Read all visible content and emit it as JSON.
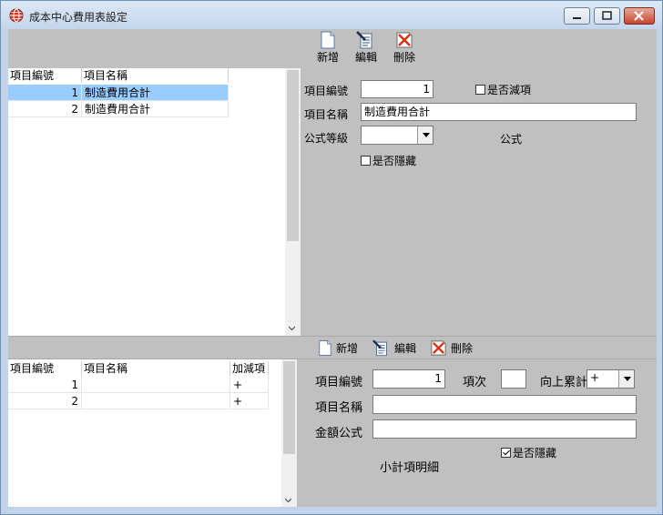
{
  "window": {
    "title": "成本中心費用表設定",
    "icon": "globe-icon"
  },
  "top": {
    "toolbar": {
      "add_label": "新增",
      "edit_label": "編輯",
      "delete_label": "刪除"
    },
    "grid": {
      "columns": [
        "項目編號",
        "項目名稱"
      ],
      "rows": [
        {
          "id": "1",
          "name": "制造費用合計",
          "selected": true
        },
        {
          "id": "2",
          "name": "制造費用合計",
          "selected": false
        }
      ]
    },
    "form": {
      "item_no_label": "項目編號",
      "item_no_value": "1",
      "is_deduct_label": "是否減項",
      "item_name_label": "項目名稱",
      "item_name_value": "制造費用合計",
      "formula_level_label": "公式等級",
      "formula_level_value": "",
      "formula_label": "公式",
      "is_hidden_label": "是否隱藏"
    }
  },
  "bottom": {
    "toolbar": {
      "add_label": "新增",
      "edit_label": "編輯",
      "delete_label": "刪除"
    },
    "grid": {
      "columns": [
        "項目編號",
        "項目名稱",
        "加減項"
      ],
      "rows": [
        {
          "id": "1",
          "name": "",
          "sign": "+"
        },
        {
          "id": "2",
          "name": "",
          "sign": "+"
        }
      ]
    },
    "form": {
      "item_no_label": "項目編號",
      "item_no_value": "1",
      "seq_label": "項次",
      "seq_value": "",
      "cumulative_label": "向上累計",
      "cumulative_value": "+",
      "item_name_label": "項目名稱",
      "item_name_value": "",
      "amount_formula_label": "金額公式",
      "amount_formula_value": "",
      "is_hidden_label": "是否隱藏",
      "is_hidden_checked": true,
      "subtotal_detail_label": "小計項明細"
    }
  }
}
